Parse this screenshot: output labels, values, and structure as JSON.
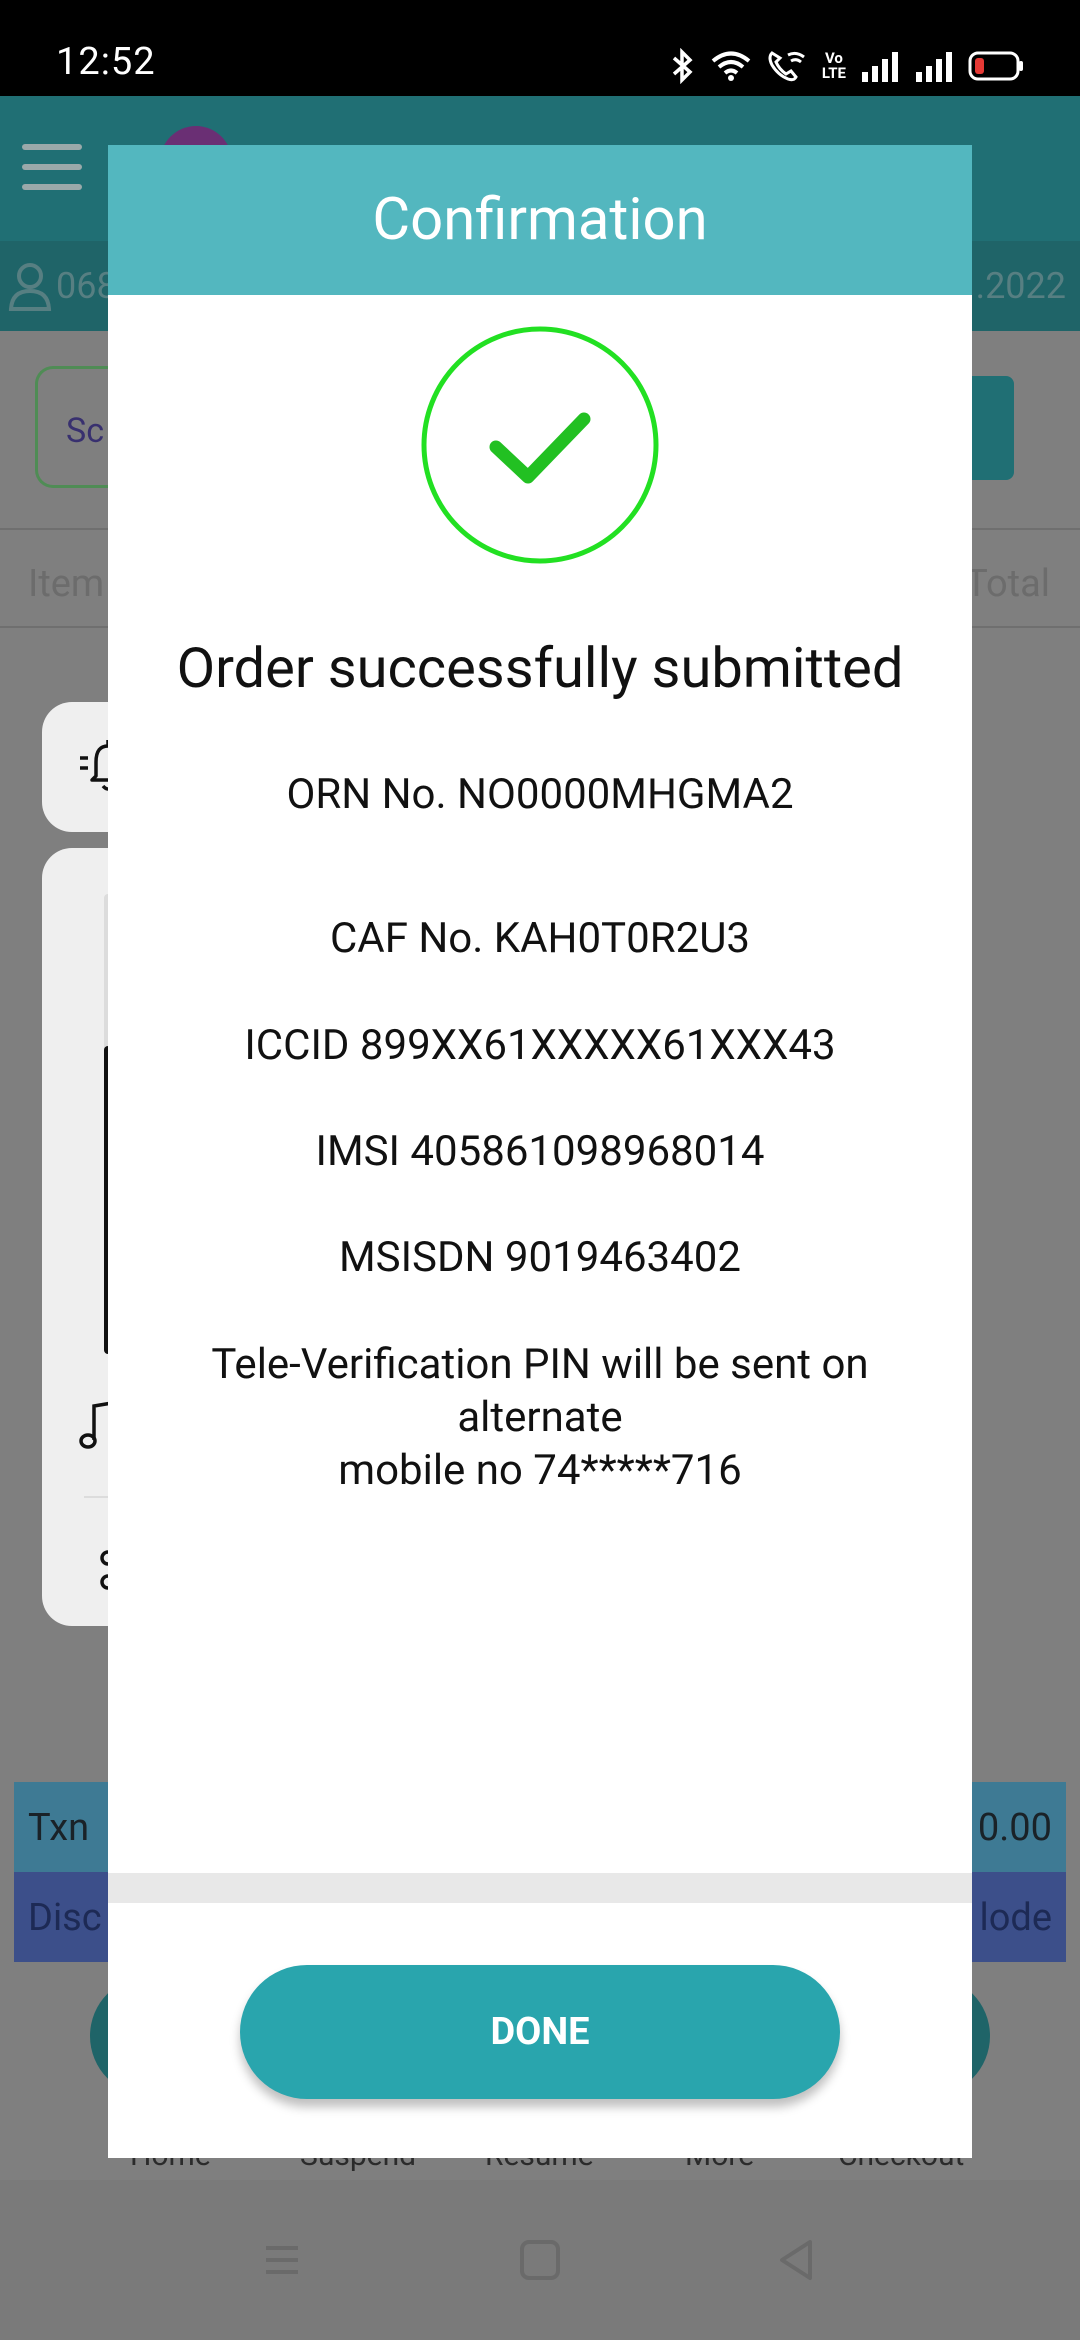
{
  "status_bar": {
    "time": "12:52",
    "volte": [
      "Vo",
      "LTE"
    ],
    "icons": [
      "bluetooth-icon",
      "wifi-icon",
      "wifi-calling-icon",
      "volte-icon",
      "signal-icon",
      "signal-icon",
      "battery-low-icon"
    ]
  },
  "background": {
    "user_id_partial": "068",
    "date_partial": ".2022",
    "scan_placeholder_partial": "Sc",
    "table_headers": {
      "item_partial": "Item",
      "total_partial": "Total"
    },
    "txn_row": {
      "label_partial": "Txn",
      "value_partial": "0.00"
    },
    "disc_row": {
      "label_partial": "Disc",
      "mode_partial": "lode"
    },
    "bottom_nav": [
      "Home",
      "Suspend",
      "Resume",
      "More",
      "Checkout"
    ]
  },
  "dialog": {
    "title": "Confirmation",
    "message": "Order successfully submitted",
    "orn": "ORN No. NO0000MHGMA2",
    "caf": "CAF No. KAH0T0R2U3",
    "iccid": "ICCID 899XX61XXXXX61XXX43",
    "imsi": "IMSI 405861098968014",
    "msisdn": "MSISDN 9019463402",
    "tele_line1": "Tele-Verification PIN will be sent on",
    "tele_line2": "alternate",
    "tele_line3": "mobile no 74*****716",
    "done_label": "DONE"
  },
  "volume_panel": {
    "level": 0.67
  },
  "colors": {
    "header": "#53b7bf",
    "done_button": "#29a5ad",
    "success_green": "#22e022"
  }
}
